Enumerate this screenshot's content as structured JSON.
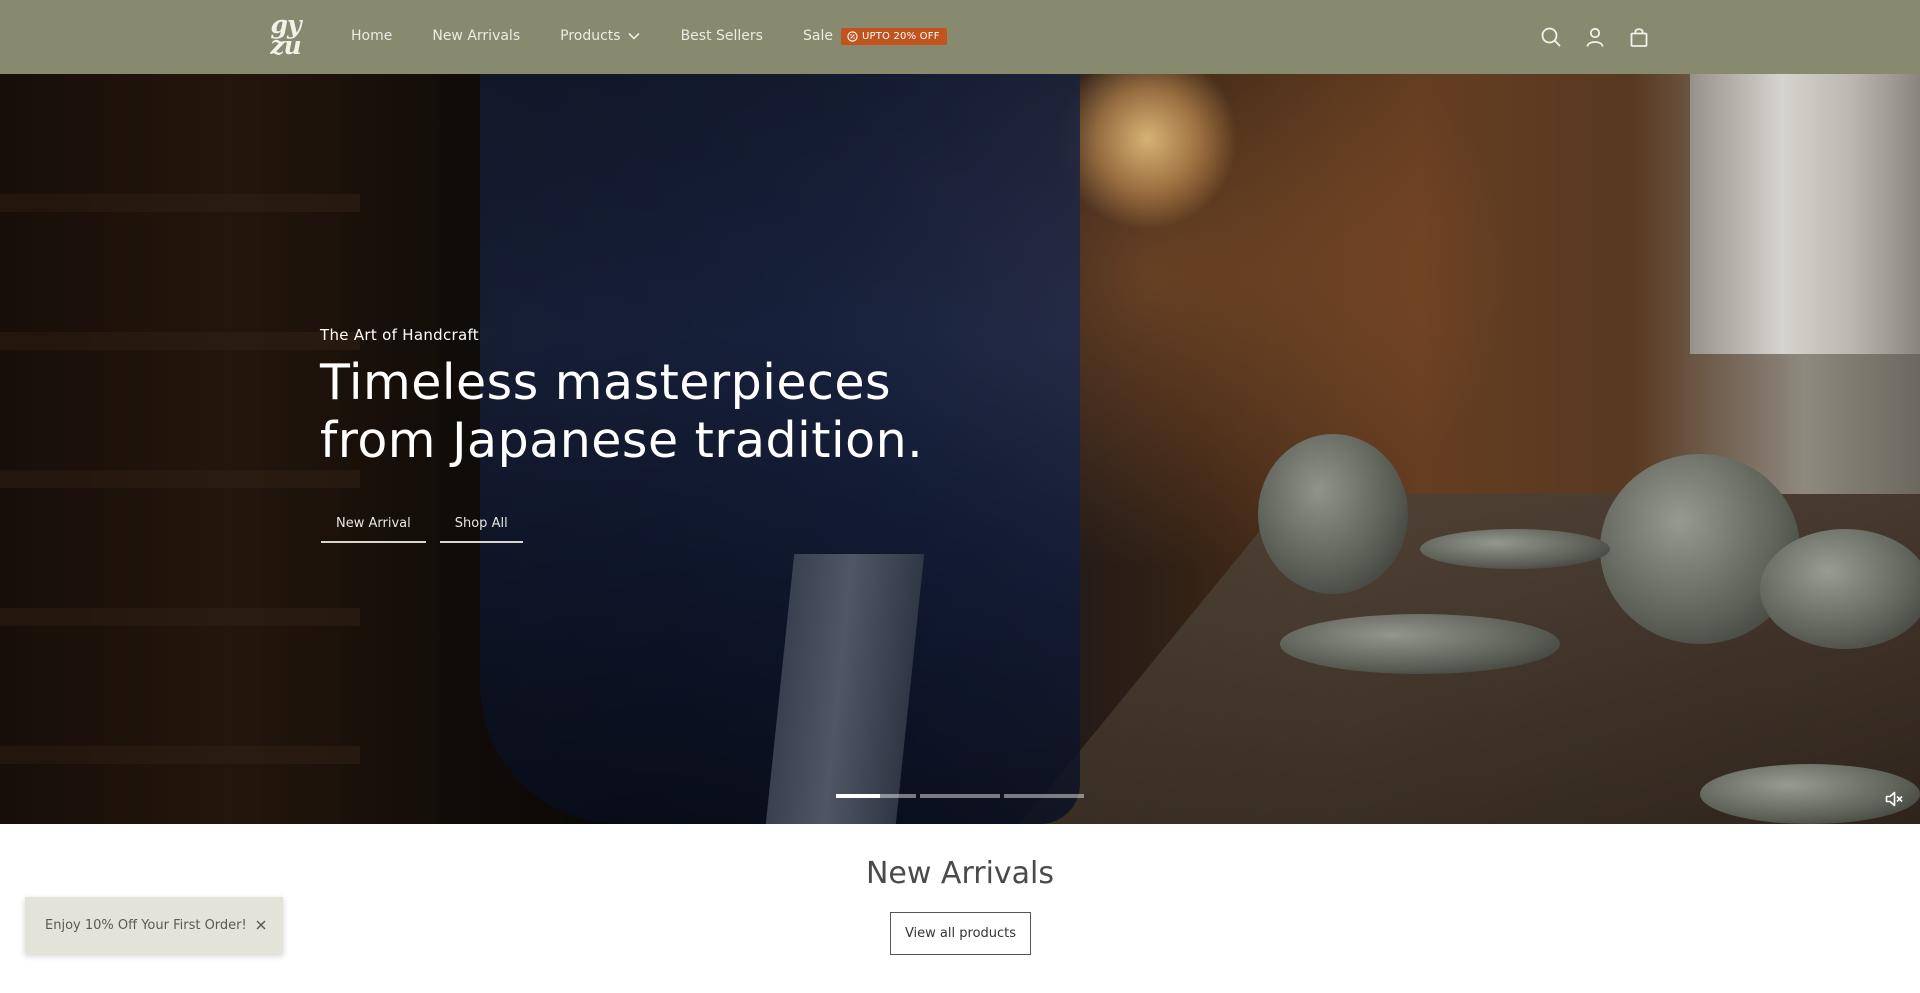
{
  "brand": {
    "logo_top": "gy",
    "logo_bottom": "zu"
  },
  "nav": {
    "items": [
      {
        "label": "Home"
      },
      {
        "label": "New Arrivals"
      },
      {
        "label": "Products"
      },
      {
        "label": "Best Sellers"
      },
      {
        "label": "Sale"
      }
    ],
    "sale_badge": "UPTO 20% OFF",
    "icons": [
      "search-icon",
      "account-icon",
      "cart-icon"
    ]
  },
  "hero": {
    "eyebrow": "The Art of Handcraft",
    "title": "Timeless masterpieces from Japanese tradition.",
    "buttons": [
      {
        "label": "New Arrival"
      },
      {
        "label": "Shop All"
      }
    ],
    "slides": {
      "count": 3,
      "active": 0,
      "active_progress": 0.55
    },
    "mute_icon": "mute-icon"
  },
  "new_arrivals": {
    "title": "New Arrivals",
    "button": "View all products"
  },
  "promo": {
    "text": "Enjoy 10% Off Your First Order!",
    "close_icon": "close-icon"
  },
  "colors": {
    "header_bg": "#878a6f",
    "sale_badge_bg": "#c0531e",
    "promo_bg": "#e4e3d9"
  }
}
